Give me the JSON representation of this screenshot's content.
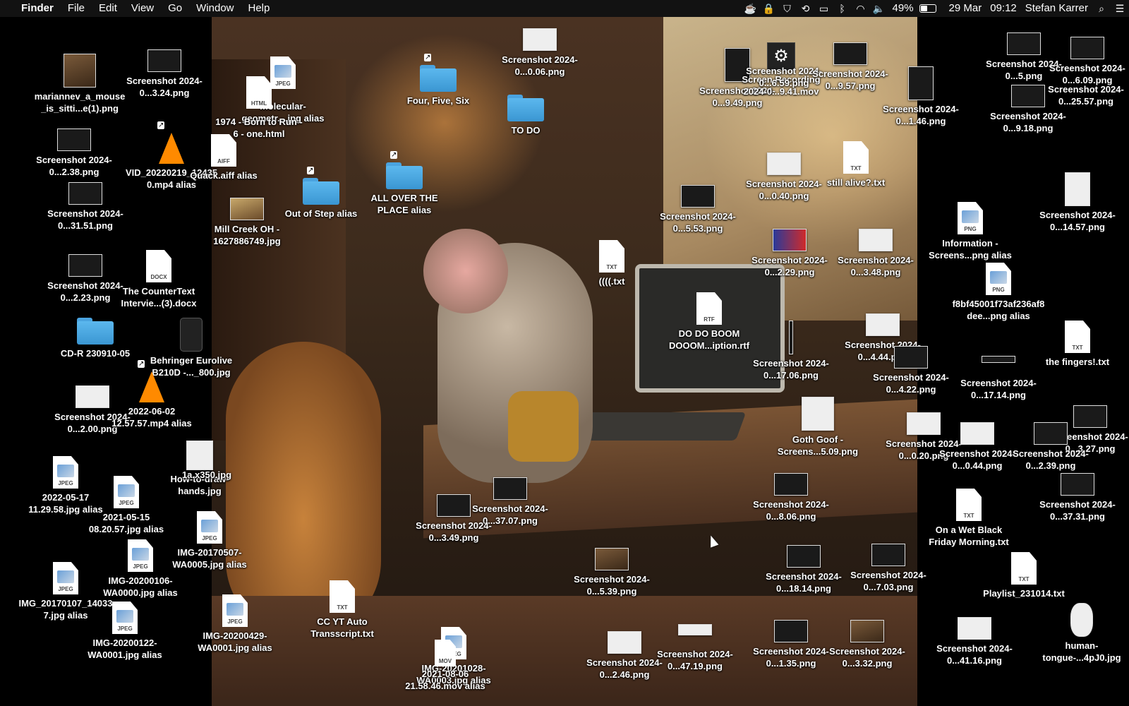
{
  "menubar": {
    "apple": "",
    "app": "Finder",
    "menus": [
      "File",
      "Edit",
      "View",
      "Go",
      "Window",
      "Help"
    ],
    "battery": "49%",
    "date": "29 Mar",
    "time": "09:12",
    "user": "Stefan Karrer"
  },
  "desktop": {
    "icons": [
      {
        "label": "mariannev_a_mouse_is_sitti...e(1).png"
      },
      {
        "label": "Screenshot 2024-0...3.24.png"
      },
      {
        "label": "Screenshot 2024-0...2.38.png"
      },
      {
        "label": "VID_20220219_124350.mp4 alias"
      },
      {
        "label": "Quack.aiff alias"
      },
      {
        "label": "Screenshot 2024-0...31.51.png"
      },
      {
        "label": "Mill Creek OH - 1627886749.jpg"
      },
      {
        "label": "Out of Step alias"
      },
      {
        "label": "ALL OVER THE PLACE alias"
      },
      {
        "label": "Screenshot 2024-0...2.23.png"
      },
      {
        "label": "The CounterText Intervie...(3).docx"
      },
      {
        "label": "CD-R 230910-05"
      },
      {
        "label": "Behringer Eurolive B210D -..._800.jpg"
      },
      {
        "label": "Screenshot 2024-0...2.00.png"
      },
      {
        "label": "2022-06-02 12.57.57.mp4 alias"
      },
      {
        "label": "How-to-draw-hands.jpg"
      },
      {
        "label": "1a.x350.jpg"
      },
      {
        "label": "2022-05-17 11.29.58.jpg alias"
      },
      {
        "label": "2021-05-15 08.20.57.jpg alias"
      },
      {
        "label": "IMG-20170507-WA0005.jpg alias"
      },
      {
        "label": "IMG-20200106-WA0000.jpg alias"
      },
      {
        "label": "IMG_20170107_140337.jpg alias"
      },
      {
        "label": "IMG-20200122-WA0001.jpg alias"
      },
      {
        "label": "IMG-20200429-WA0001.jpg alias"
      },
      {
        "label": "CC YT Auto Transscript.txt"
      },
      {
        "label": "IMG-20201028-WA0003.jpg alias"
      },
      {
        "label": "2021-08-06 21.58.46.mov alias"
      },
      {
        "label": "molecular-geometr....jpg alias"
      },
      {
        "label": "1974 - Born to Run - 6 - one.html"
      },
      {
        "label": "Four, Five, Six"
      },
      {
        "label": "Screenshot 2024-0...0.06.png"
      },
      {
        "label": "TO DO"
      },
      {
        "label": "Screenshot 2024-0...9.49.png"
      },
      {
        "label": "Screen Recording 2024-0...9.41.mov"
      },
      {
        "label": "Screenshot 2024-0...6.59.png"
      },
      {
        "label": "Screenshot 2024-0...9.57.png"
      },
      {
        "label": "Screenshot 2024-0...1.46.png"
      },
      {
        "label": "Screenshot 2024-0...0.40.png"
      },
      {
        "label": "still alive?.txt"
      },
      {
        "label": "Screenshot 2024-0...5.53.png"
      },
      {
        "label": "((((.txt"
      },
      {
        "label": "Screenshot 2024-0...2.29.png"
      },
      {
        "label": "Screenshot 2024-0...3.48.png"
      },
      {
        "label": "DO DO BOOM DOOOM...iption.rtf"
      },
      {
        "label": "Screenshot 2024-0...17.06.png"
      },
      {
        "label": "Screenshot 2024-0...4.44.png"
      },
      {
        "label": "Screenshot 2024-0...4.22.png"
      },
      {
        "label": "Goth Goof - Screens...5.09.png"
      },
      {
        "label": "Screenshot 2024-0...0.20.png"
      },
      {
        "label": "Screenshot 2024-0...37.07.png"
      },
      {
        "label": "Screenshot 2024-0...3.49.png"
      },
      {
        "label": "Screenshot 2024-0...8.06.png"
      },
      {
        "label": "Screenshot 2024-0...5.39.png"
      },
      {
        "label": "Screenshot 2024-0...18.14.png"
      },
      {
        "label": "Screenshot 2024-0...7.03.png"
      },
      {
        "label": "Screenshot 2024-0...2.46.png"
      },
      {
        "label": "Screenshot 2024-0...47.19.png"
      },
      {
        "label": "Screenshot 2024-0...1.35.png"
      },
      {
        "label": "Screenshot 2024-0...3.32.png"
      },
      {
        "label": "Screenshot 2024-0...5.png"
      },
      {
        "label": "Screenshot 2024-0...6.09.png"
      },
      {
        "label": "Screenshot 2024-0...25.57.png"
      },
      {
        "label": "Screenshot 2024-0...9.18.png"
      },
      {
        "label": "Screenshot 2024-0...14.57.png"
      },
      {
        "label": "Information - Screens...png alias"
      },
      {
        "label": "f8bf45001f73af236af8dee...png alias"
      },
      {
        "label": "the fingers!.txt"
      },
      {
        "label": "Screenshot 2024-0...17.14.png"
      },
      {
        "label": "Screenshot 2024-0...3.27.png"
      },
      {
        "label": "Screenshot 2024-0...0.44.png"
      },
      {
        "label": "Screenshot 2024-0...2.39.png"
      },
      {
        "label": "Screenshot 2024-0...37.31.png"
      },
      {
        "label": "On a Wet Black Friday Morning.txt"
      },
      {
        "label": "Playlist_231014.txt"
      },
      {
        "label": "Screenshot 2024-0...41.16.png"
      },
      {
        "label": "human-tongue-...4pJ0.jpg"
      }
    ]
  }
}
